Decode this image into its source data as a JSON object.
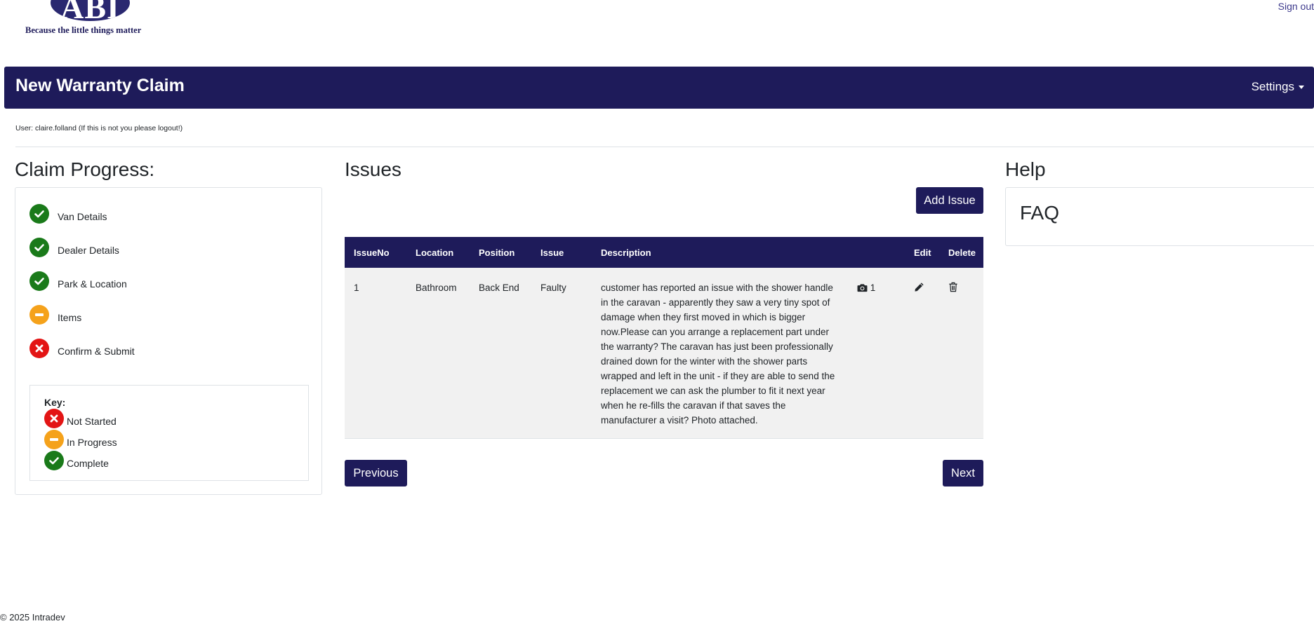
{
  "logo": {
    "text": "ABI",
    "tagline": "Because the little things matter"
  },
  "top": {
    "signout_label": "Sign out"
  },
  "header": {
    "title": "New Warranty Claim",
    "settings_label": "Settings"
  },
  "user": {
    "line": "User: claire.folland (If this is not you please logout!)"
  },
  "progress": {
    "title": "Claim Progress:",
    "steps": [
      {
        "label": "Van Details",
        "status": "complete"
      },
      {
        "label": "Dealer Details",
        "status": "complete"
      },
      {
        "label": "Park & Location",
        "status": "complete"
      },
      {
        "label": "Items",
        "status": "in-progress"
      },
      {
        "label": "Confirm & Submit",
        "status": "not-started"
      }
    ],
    "key": {
      "title": "Key:",
      "items": [
        {
          "label": "Not Started",
          "status": "not-started"
        },
        {
          "label": "In Progress",
          "status": "in-progress"
        },
        {
          "label": "Complete",
          "status": "complete"
        }
      ]
    }
  },
  "issues": {
    "title": "Issues",
    "add_label": "Add Issue",
    "columns": [
      "IssueNo",
      "Location",
      "Position",
      "Issue",
      "Description",
      "",
      "Edit",
      "Delete"
    ],
    "rows": [
      {
        "issue_no": "1",
        "location": "Bathroom",
        "position": "Back End",
        "issue": "Faulty",
        "description": "customer has reported an issue with the shower handle in the caravan - apparently they saw a very tiny spot of damage when they first moved in which is bigger now.Please can you arrange a replacement part under the warranty? The caravan has just been professionally drained down for the winter with the shower parts wrapped and left in the unit - if they are able to send the replacement we can ask the plumber to fit it next year when he re-fills the caravan if that saves the manufacturer a visit? Photo attached.",
        "photo_count": "1"
      }
    ],
    "prev_label": "Previous",
    "next_label": "Next"
  },
  "help": {
    "title": "Help",
    "faq": "FAQ"
  },
  "footer": {
    "text": "© 2025 Intradev"
  },
  "colors": {
    "navy": "#1e1b5a",
    "complete": "#1a7a1a",
    "in_progress": "#f5a21b",
    "not_started": "#e31515"
  },
  "icons": {
    "complete": "check-circle-icon",
    "in_progress": "minus-circle-icon",
    "not_started": "x-circle-icon",
    "photo": "camera-icon",
    "edit": "pencil-icon",
    "delete": "trash-icon",
    "settings": "caret-down-icon"
  }
}
